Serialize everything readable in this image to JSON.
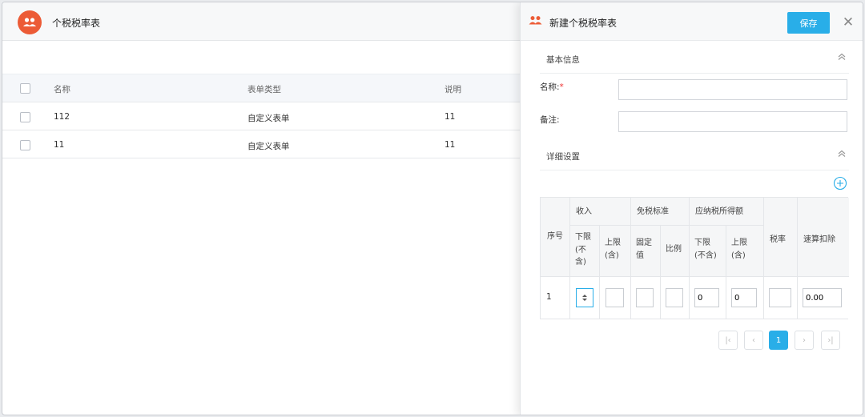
{
  "page": {
    "title": "个税税率表"
  },
  "table": {
    "headers": {
      "name": "名称",
      "form_type": "表单类型",
      "description": "说明"
    },
    "rows": [
      {
        "name": "112",
        "form_type": "自定义表单",
        "description": "11"
      },
      {
        "name": "11",
        "form_type": "自定义表单",
        "description": "11"
      }
    ]
  },
  "panel": {
    "title": "新建个税税率表",
    "save_label": "保存",
    "close_glyph": "✕",
    "basic_section": "基本信息",
    "name_label": "名称:",
    "required_mark": "*",
    "remark_label": "备注:",
    "name_value": "",
    "remark_value": "",
    "detail_section": "详细设置",
    "detail_table": {
      "seq": "序号",
      "income": "收入",
      "income_lower": [
        "下限",
        "(不",
        "含)"
      ],
      "income_upper": [
        "上限",
        "(含)"
      ],
      "exempt": "免税标准",
      "exempt_fixed": [
        "固定",
        "值"
      ],
      "exempt_ratio": "比例",
      "taxable": "应纳税所得额",
      "taxable_lower": [
        "下限",
        "(不含)"
      ],
      "taxable_upper": [
        "上限",
        "(含)"
      ],
      "rate": "税率",
      "deduction": "速算扣除",
      "row": {
        "seq": "1",
        "income_lower": "",
        "income_upper": "",
        "exempt_fixed": "",
        "exempt_ratio": "",
        "taxable_lower": "0",
        "taxable_upper": "0",
        "rate": "",
        "deduction": "0.00"
      }
    },
    "pager": {
      "first": "|‹",
      "prev": "‹",
      "current": "1",
      "next": "›",
      "last": "›|"
    }
  }
}
